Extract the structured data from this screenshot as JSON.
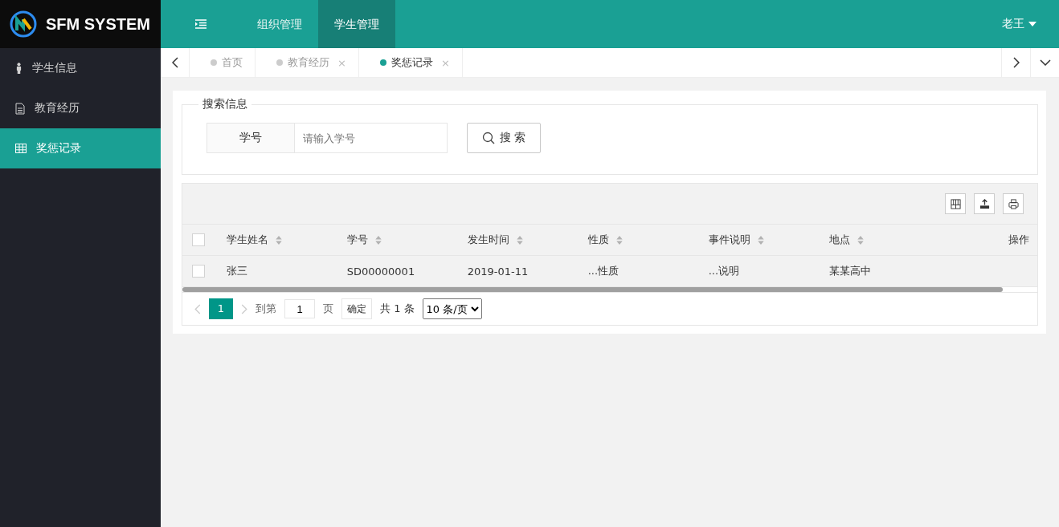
{
  "logo": {
    "title": "SFM SYSTEM"
  },
  "top_nav": [
    {
      "label": "组织管理",
      "selected": false
    },
    {
      "label": "学生管理",
      "selected": true
    }
  ],
  "user": {
    "name": "老王"
  },
  "sidebar": {
    "items": [
      {
        "label": "学生信息",
        "kind": "person",
        "selected": false
      },
      {
        "label": "教育经历",
        "kind": "document",
        "selected": false
      },
      {
        "label": "奖惩记录",
        "kind": "table",
        "selected": true
      }
    ]
  },
  "tabs": [
    {
      "label": "首页",
      "selected": false
    },
    {
      "label": "教育经历",
      "close": "×",
      "selected": false
    },
    {
      "label": "奖惩记录",
      "close": "×",
      "selected": true
    }
  ],
  "search": {
    "legend": "搜索信息",
    "field_label": "学号",
    "placeholder": "请输入学号",
    "button": "搜 索"
  },
  "table": {
    "all_checked": false,
    "columns": [
      {
        "label": "学生姓名",
        "sortable": true
      },
      {
        "label": "学号",
        "sortable": true
      },
      {
        "label": "发生时间",
        "sortable": true
      },
      {
        "label": "性质",
        "sortable": true
      },
      {
        "label": "事件说明",
        "sortable": true
      },
      {
        "label": "地点",
        "sortable": true
      },
      {
        "label": "操作",
        "sortable": false
      }
    ],
    "rows": [
      {
        "checked": false,
        "cells": [
          "张三",
          "SD00000001",
          "2019-01-11",
          "...性质",
          "...说明",
          "某某高中",
          ""
        ]
      }
    ]
  },
  "pagination": {
    "pages": [
      {
        "label": "1",
        "selected": true
      }
    ],
    "goto_label": "到第",
    "goto_value": "1",
    "page_unit": "页",
    "confirm": "确定",
    "total": "共 1 条",
    "page_size": "10 条/页"
  }
}
